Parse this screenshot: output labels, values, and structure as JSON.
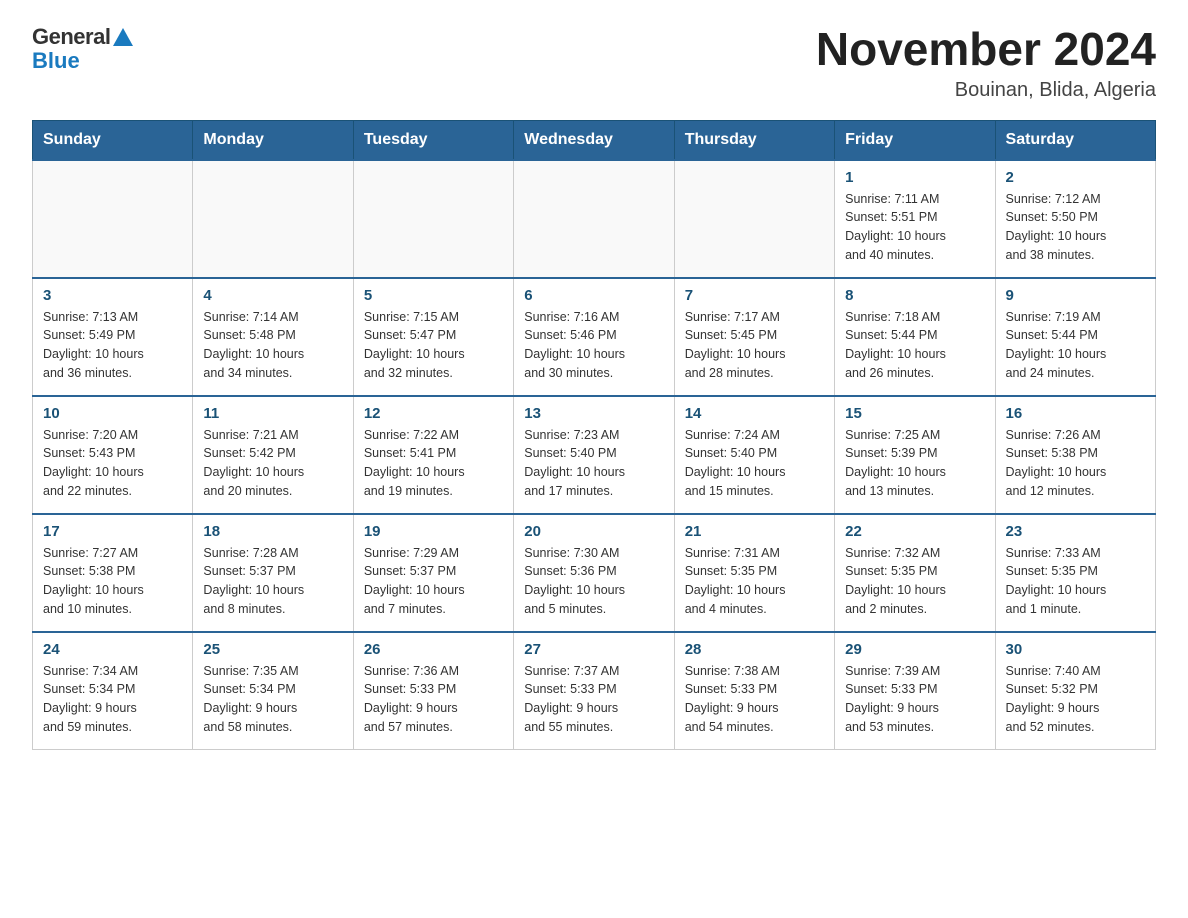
{
  "header": {
    "logo_text": "General",
    "logo_blue": "Blue",
    "month_title": "November 2024",
    "location": "Bouinan, Blida, Algeria"
  },
  "weekdays": [
    "Sunday",
    "Monday",
    "Tuesday",
    "Wednesday",
    "Thursday",
    "Friday",
    "Saturday"
  ],
  "weeks": [
    [
      {
        "day": "",
        "info": ""
      },
      {
        "day": "",
        "info": ""
      },
      {
        "day": "",
        "info": ""
      },
      {
        "day": "",
        "info": ""
      },
      {
        "day": "",
        "info": ""
      },
      {
        "day": "1",
        "info": "Sunrise: 7:11 AM\nSunset: 5:51 PM\nDaylight: 10 hours\nand 40 minutes."
      },
      {
        "day": "2",
        "info": "Sunrise: 7:12 AM\nSunset: 5:50 PM\nDaylight: 10 hours\nand 38 minutes."
      }
    ],
    [
      {
        "day": "3",
        "info": "Sunrise: 7:13 AM\nSunset: 5:49 PM\nDaylight: 10 hours\nand 36 minutes."
      },
      {
        "day": "4",
        "info": "Sunrise: 7:14 AM\nSunset: 5:48 PM\nDaylight: 10 hours\nand 34 minutes."
      },
      {
        "day": "5",
        "info": "Sunrise: 7:15 AM\nSunset: 5:47 PM\nDaylight: 10 hours\nand 32 minutes."
      },
      {
        "day": "6",
        "info": "Sunrise: 7:16 AM\nSunset: 5:46 PM\nDaylight: 10 hours\nand 30 minutes."
      },
      {
        "day": "7",
        "info": "Sunrise: 7:17 AM\nSunset: 5:45 PM\nDaylight: 10 hours\nand 28 minutes."
      },
      {
        "day": "8",
        "info": "Sunrise: 7:18 AM\nSunset: 5:44 PM\nDaylight: 10 hours\nand 26 minutes."
      },
      {
        "day": "9",
        "info": "Sunrise: 7:19 AM\nSunset: 5:44 PM\nDaylight: 10 hours\nand 24 minutes."
      }
    ],
    [
      {
        "day": "10",
        "info": "Sunrise: 7:20 AM\nSunset: 5:43 PM\nDaylight: 10 hours\nand 22 minutes."
      },
      {
        "day": "11",
        "info": "Sunrise: 7:21 AM\nSunset: 5:42 PM\nDaylight: 10 hours\nand 20 minutes."
      },
      {
        "day": "12",
        "info": "Sunrise: 7:22 AM\nSunset: 5:41 PM\nDaylight: 10 hours\nand 19 minutes."
      },
      {
        "day": "13",
        "info": "Sunrise: 7:23 AM\nSunset: 5:40 PM\nDaylight: 10 hours\nand 17 minutes."
      },
      {
        "day": "14",
        "info": "Sunrise: 7:24 AM\nSunset: 5:40 PM\nDaylight: 10 hours\nand 15 minutes."
      },
      {
        "day": "15",
        "info": "Sunrise: 7:25 AM\nSunset: 5:39 PM\nDaylight: 10 hours\nand 13 minutes."
      },
      {
        "day": "16",
        "info": "Sunrise: 7:26 AM\nSunset: 5:38 PM\nDaylight: 10 hours\nand 12 minutes."
      }
    ],
    [
      {
        "day": "17",
        "info": "Sunrise: 7:27 AM\nSunset: 5:38 PM\nDaylight: 10 hours\nand 10 minutes."
      },
      {
        "day": "18",
        "info": "Sunrise: 7:28 AM\nSunset: 5:37 PM\nDaylight: 10 hours\nand 8 minutes."
      },
      {
        "day": "19",
        "info": "Sunrise: 7:29 AM\nSunset: 5:37 PM\nDaylight: 10 hours\nand 7 minutes."
      },
      {
        "day": "20",
        "info": "Sunrise: 7:30 AM\nSunset: 5:36 PM\nDaylight: 10 hours\nand 5 minutes."
      },
      {
        "day": "21",
        "info": "Sunrise: 7:31 AM\nSunset: 5:35 PM\nDaylight: 10 hours\nand 4 minutes."
      },
      {
        "day": "22",
        "info": "Sunrise: 7:32 AM\nSunset: 5:35 PM\nDaylight: 10 hours\nand 2 minutes."
      },
      {
        "day": "23",
        "info": "Sunrise: 7:33 AM\nSunset: 5:35 PM\nDaylight: 10 hours\nand 1 minute."
      }
    ],
    [
      {
        "day": "24",
        "info": "Sunrise: 7:34 AM\nSunset: 5:34 PM\nDaylight: 9 hours\nand 59 minutes."
      },
      {
        "day": "25",
        "info": "Sunrise: 7:35 AM\nSunset: 5:34 PM\nDaylight: 9 hours\nand 58 minutes."
      },
      {
        "day": "26",
        "info": "Sunrise: 7:36 AM\nSunset: 5:33 PM\nDaylight: 9 hours\nand 57 minutes."
      },
      {
        "day": "27",
        "info": "Sunrise: 7:37 AM\nSunset: 5:33 PM\nDaylight: 9 hours\nand 55 minutes."
      },
      {
        "day": "28",
        "info": "Sunrise: 7:38 AM\nSunset: 5:33 PM\nDaylight: 9 hours\nand 54 minutes."
      },
      {
        "day": "29",
        "info": "Sunrise: 7:39 AM\nSunset: 5:33 PM\nDaylight: 9 hours\nand 53 minutes."
      },
      {
        "day": "30",
        "info": "Sunrise: 7:40 AM\nSunset: 5:32 PM\nDaylight: 9 hours\nand 52 minutes."
      }
    ]
  ]
}
